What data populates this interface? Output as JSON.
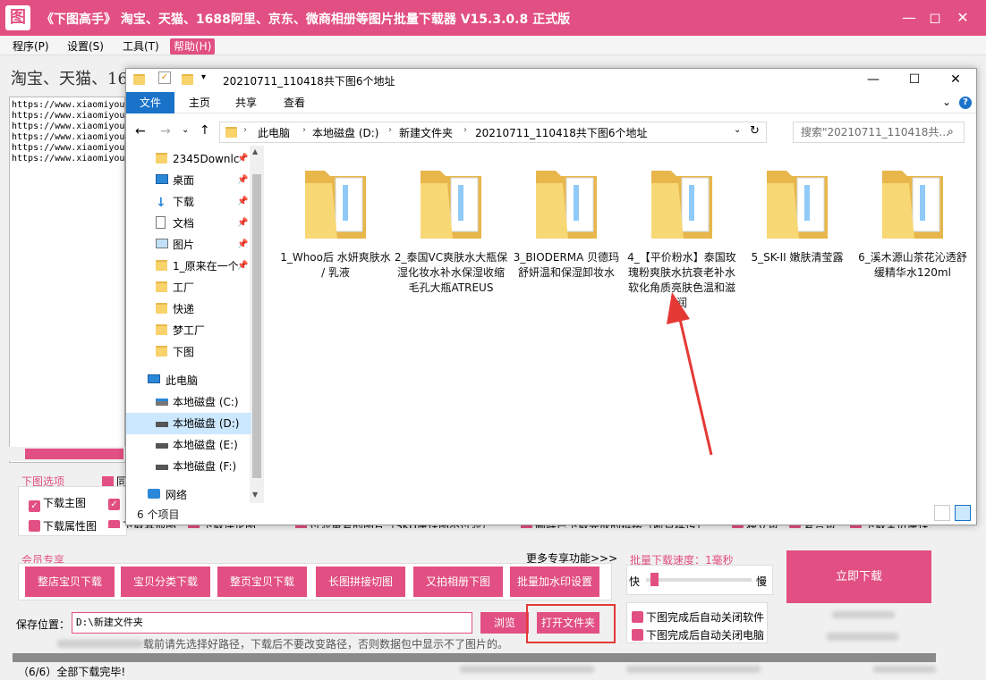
{
  "app": {
    "title": "《下图高手》 淘宝、天猫、1688阿里、京东、微商相册等图片批量下载器 V15.3.0.8 正式版",
    "icon_glyph": "图",
    "accent": "#e24f82"
  },
  "menu": [
    "程序(P)",
    "设置(S)",
    "工具(T)",
    "帮助(H)"
  ],
  "main": {
    "heading": "淘宝、天猫、16",
    "urls": [
      "https://www.xiaomiyou",
      "https://www.xiaomiyou",
      "https://www.xiaomiyou",
      "https://www.xiaomiyou",
      "https://www.xiaomiyou",
      "https://www.xiaomiyou"
    ],
    "download_options_label": "下图选项",
    "opt_main": "下载主图",
    "opt_attr": "下载属性图",
    "opt_detail_partial": "下载其他图",
    "opt_review_partial": "下载评论图",
    "opt_same": "同",
    "dedupe_text": "过滤重复的图片（SKU属性图不过滤）",
    "delete_text": "删除已下载完成的链接（断点续传）",
    "opt_right1": "独立包",
    "opt_right2": "复合包",
    "opt_right3": "下载宝贝属性",
    "member_label": "会员专享",
    "more_features": "更多专享功能>>>",
    "member_buttons": [
      "整店宝贝下载",
      "宝贝分类下载",
      "整页宝贝下载",
      "长图拼接切图",
      "又拍相册下图",
      "批量加水印设置"
    ],
    "speed_label": "批量下载速度：1毫秒",
    "speed_fast": "快",
    "speed_slow": "慢",
    "start_button": "立即下载",
    "close_after_software": "下图完成后自动关闭软件",
    "close_after_pc": "下图完成后自动关闭电脑",
    "save_label": "保存位置：",
    "save_path": "D:\\新建文件夹",
    "browse_button": "浏览",
    "open_folder_button": "打开文件夹",
    "hint": "载前请先选择好路径，下载后不要改变路径，否则数据包中显示不了图片的。",
    "status": "（6/6）全部下载完毕!"
  },
  "explorer": {
    "title": "20210711_110418共下图6个地址",
    "ribbon_tabs": [
      "文件",
      "主页",
      "共享",
      "查看"
    ],
    "breadcrumb": [
      "此电脑",
      "本地磁盘 (D:)",
      "新建文件夹",
      "20210711_110418共下图6个地址"
    ],
    "search_placeholder": "搜索\"20210711_110418共...",
    "nav_items": [
      {
        "label": "2345Downlc",
        "icon": "folder-icon",
        "pinned": true
      },
      {
        "label": "桌面",
        "icon": "desktop-icon",
        "pinned": true
      },
      {
        "label": "下载",
        "icon": "download-icon",
        "pinned": true
      },
      {
        "label": "文档",
        "icon": "document-icon",
        "pinned": true
      },
      {
        "label": "图片",
        "icon": "picture-icon",
        "pinned": true
      },
      {
        "label": "1_原来在一个",
        "icon": "folder-icon",
        "pinned": true
      },
      {
        "label": "工厂",
        "icon": "folder-icon",
        "pinned": false
      },
      {
        "label": "快递",
        "icon": "folder-icon",
        "pinned": false
      },
      {
        "label": "梦工厂",
        "icon": "folder-icon",
        "pinned": false
      },
      {
        "label": "下图",
        "icon": "folder-icon",
        "pinned": false
      }
    ],
    "this_pc": "此电脑",
    "drives": [
      "本地磁盘 (C:)",
      "本地磁盘 (D:)",
      "本地磁盘 (E:)",
      "本地磁盘 (F:)"
    ],
    "network": "网络",
    "files": [
      "1_Whoo后 水妍爽肤水 / 乳液",
      "2_泰国VC爽肤水大瓶保湿化妆水补水保湿收缩毛孔大瓶ATREUS",
      "3_BIODERMA 贝德玛 舒妍温和保湿卸妆水",
      "4_【平价粉水】泰国玫瑰粉爽肤水抗衰老补水软化角质亮肤色温和滋润",
      "5_SK-II 嫩肤清莹露",
      "6_溪木源山茶花沁透舒缓精华水120ml"
    ],
    "status": "6 个项目"
  }
}
